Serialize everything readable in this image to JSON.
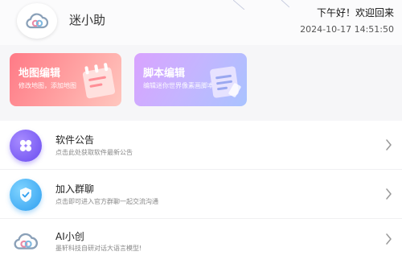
{
  "header": {
    "app_name": "迷小助",
    "greeting": "下午好！欢迎回来",
    "datetime": "2024-10-17 14:51:50",
    "avatar_icon": "cloud-icon"
  },
  "cards": [
    {
      "title": "地图编辑",
      "subtitle": "修改地图，添加地图",
      "icon": "notebook-icon",
      "colors": [
        "#ff7a86",
        "#ffc7bf"
      ]
    },
    {
      "title": "脚本编辑",
      "subtitle": "编辑迷你世界像素画脚本",
      "icon": "document-icon",
      "colors": [
        "#d9a3ff",
        "#a9c3ff"
      ]
    }
  ],
  "list": [
    {
      "title": "软件公告",
      "subtitle": "点击此处获取软件最新公告",
      "icon": "clover-icon",
      "icon_color": "#6a4cf0"
    },
    {
      "title": "加入群聊",
      "subtitle": "点击即可进入官方群聊一起交流沟通",
      "icon": "shield-icon",
      "icon_color": "#2f9ff0"
    },
    {
      "title": "AI小创",
      "subtitle": "墨轩科技自研对话大语言模型!",
      "icon": "cloud-icon",
      "icon_color": "#ffffff"
    }
  ]
}
